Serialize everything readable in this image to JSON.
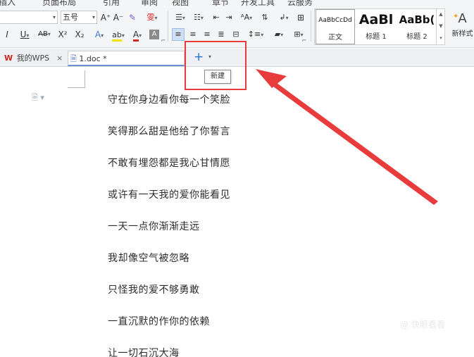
{
  "menu": [
    "插入",
    "页面布局",
    "引用",
    "审阅",
    "视图",
    "章节",
    "开发工具",
    "云服务"
  ],
  "ribbon": {
    "font_size": "五号",
    "grow_font": "A⁺",
    "shrink_font": "A⁻",
    "phonetic": "雯",
    "italic": "I",
    "underline": "U",
    "strikethrough": "AB",
    "superscript": "X²",
    "subscript": "X₂",
    "text_effect": "A",
    "highlight": "ab",
    "font_color": "A",
    "char_shade": "A",
    "dropdown_caret": "▾",
    "dialog_launcher": "⌐",
    "styles": [
      {
        "preview": "AaBbCcDd",
        "label": "正文"
      },
      {
        "preview": "AaBl",
        "label": "标题 1"
      },
      {
        "preview": "AaBb(",
        "label": "标题 2"
      }
    ],
    "new_style": "新样式",
    "new_style_icon": "A"
  },
  "tabs": {
    "home_label": "我的WPS",
    "home_logo": "W",
    "doc_label": "1.doc *",
    "close": "×",
    "new_tab": "+",
    "new_tab_caret": "▾"
  },
  "tooltip": "新建",
  "document": {
    "lines": [
      "守在你身边看你每一个笑脸",
      "笑得那么甜是他给了你誓言",
      "不敢有埋怨都是我心甘情愿",
      "或许有一天我的爱你能看见",
      "一天一点你渐渐走远",
      "我却像空气被忽略",
      "只怪我的爱不够勇敢",
      "一直沉默的作你的依赖",
      "让一切石沉大海"
    ]
  },
  "colors": {
    "highlight_border": "#e83b3b",
    "arrow": "#e83b3b",
    "accent": "#2a6fd0"
  },
  "watermark": "@ 快眼看看"
}
